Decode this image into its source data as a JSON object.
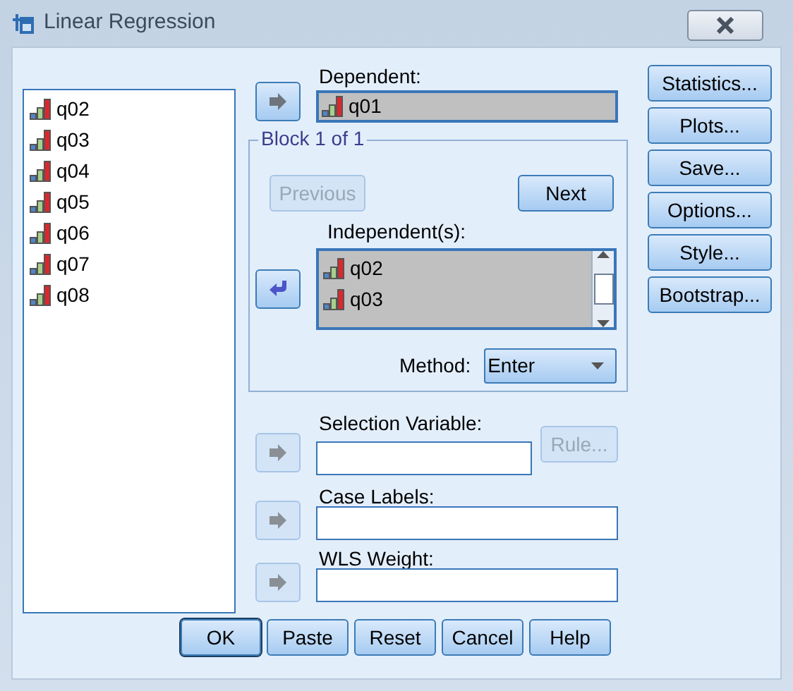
{
  "window": {
    "title": "Linear Regression"
  },
  "variables": [
    {
      "name": "q02"
    },
    {
      "name": "q03"
    },
    {
      "name": "q04"
    },
    {
      "name": "q05"
    },
    {
      "name": "q06"
    },
    {
      "name": "q07"
    },
    {
      "name": "q08"
    }
  ],
  "dependent": {
    "label": "Dependent:",
    "arrow": {
      "kind": "in",
      "disabled": false
    },
    "items": [
      {
        "name": "q01"
      }
    ]
  },
  "block": {
    "title": "Block 1 of 1",
    "previous": {
      "label": "Previous",
      "disabled": true
    },
    "next": {
      "label": "Next",
      "disabled": false
    },
    "independents_label": "Independent(s):",
    "arrow": {
      "kind": "out",
      "disabled": false
    },
    "independents": [
      {
        "name": "q02"
      },
      {
        "name": "q03"
      }
    ],
    "method_label": "Method:",
    "method": "Enter"
  },
  "selection_variable": {
    "label": "Selection Variable:",
    "arrow": {
      "kind": "in",
      "disabled": true
    },
    "rule": {
      "label": "Rule...",
      "disabled": true
    }
  },
  "case_labels": {
    "label": "Case Labels:",
    "arrow": {
      "kind": "in",
      "disabled": true
    }
  },
  "wls_weight": {
    "label": "WLS Weight:",
    "arrow": {
      "kind": "in",
      "disabled": true
    }
  },
  "side_buttons": [
    {
      "label": "Statistics..."
    },
    {
      "label": "Plots..."
    },
    {
      "label": "Save..."
    },
    {
      "label": "Options..."
    },
    {
      "label": "Style..."
    },
    {
      "label": "Bootstrap..."
    }
  ],
  "buttons": [
    {
      "label": "OK",
      "default": true
    },
    {
      "label": "Paste",
      "default": false
    },
    {
      "label": "Reset",
      "default": false
    },
    {
      "label": "Cancel",
      "default": false
    },
    {
      "label": "Help",
      "default": false
    }
  ]
}
